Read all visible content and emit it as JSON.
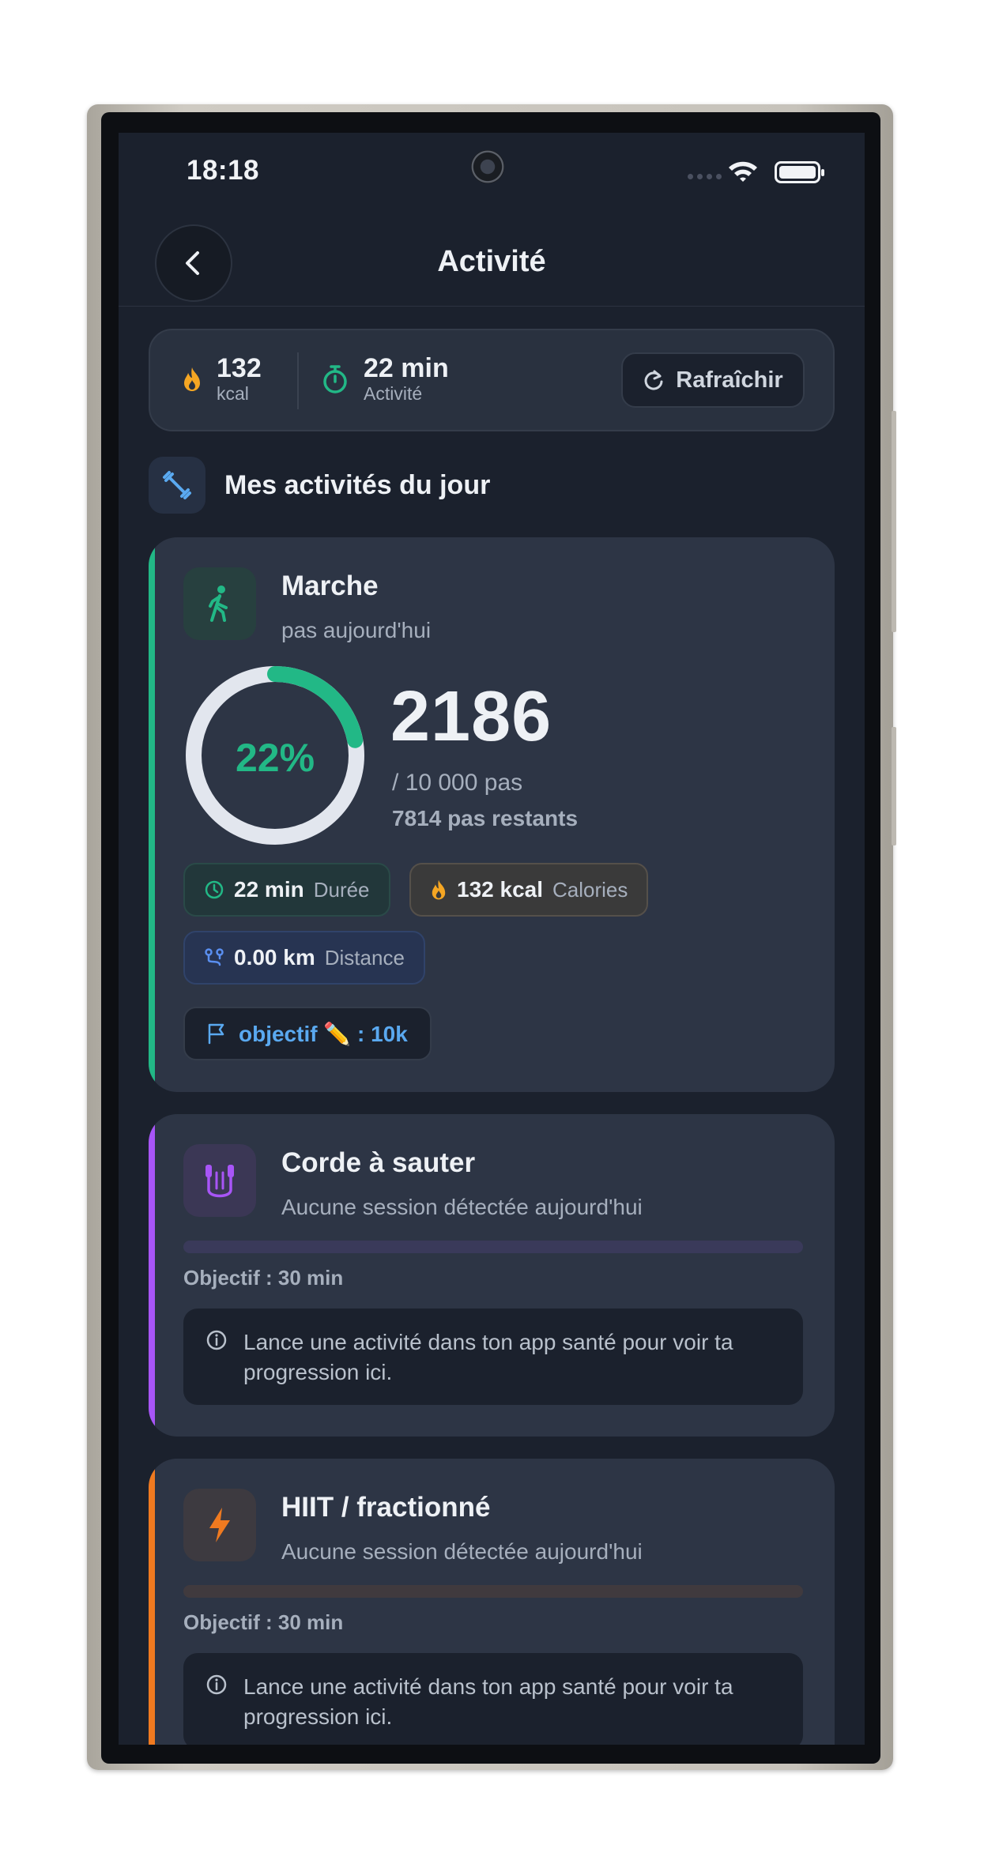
{
  "status_bar": {
    "time": "18:18"
  },
  "header": {
    "title": "Activité"
  },
  "summary": {
    "calories_value": "132",
    "calories_unit": "kcal",
    "activity_value": "22 min",
    "activity_label": "Activité",
    "refresh_label": "Rafraîchir"
  },
  "section": {
    "title": "Mes activités du jour"
  },
  "walking": {
    "title": "Marche",
    "subtitle": "pas aujourd'hui",
    "percent_label": "22%",
    "progress": 0.22,
    "steps": "2186",
    "goal_text": "/ 10 000 pas",
    "remaining_text": "7814 pas restants",
    "duration_value": "22 min",
    "duration_label": "Durée",
    "calories_value": "132 kcal",
    "calories_label": "Calories",
    "distance_value": "0.00 km",
    "distance_label": "Distance",
    "goal_pill": "objectif ✏️ : 10k",
    "accent_color": "#22b886"
  },
  "jump_rope": {
    "title": "Corde à sauter",
    "subtitle": "Aucune session détectée aujourd'hui",
    "objective": "Objectif : 30 min",
    "info": "Lance une activité dans ton app santé pour voir ta progression ici.",
    "accent_color": "#a855f7"
  },
  "hiit": {
    "title": "HIIT / fractionné",
    "subtitle": "Aucune session détectée aujourd'hui",
    "objective": "Objectif : 30 min",
    "info": "Lance une activité dans ton app santé pour voir ta progression ici.",
    "accent_color": "#f07a20"
  }
}
